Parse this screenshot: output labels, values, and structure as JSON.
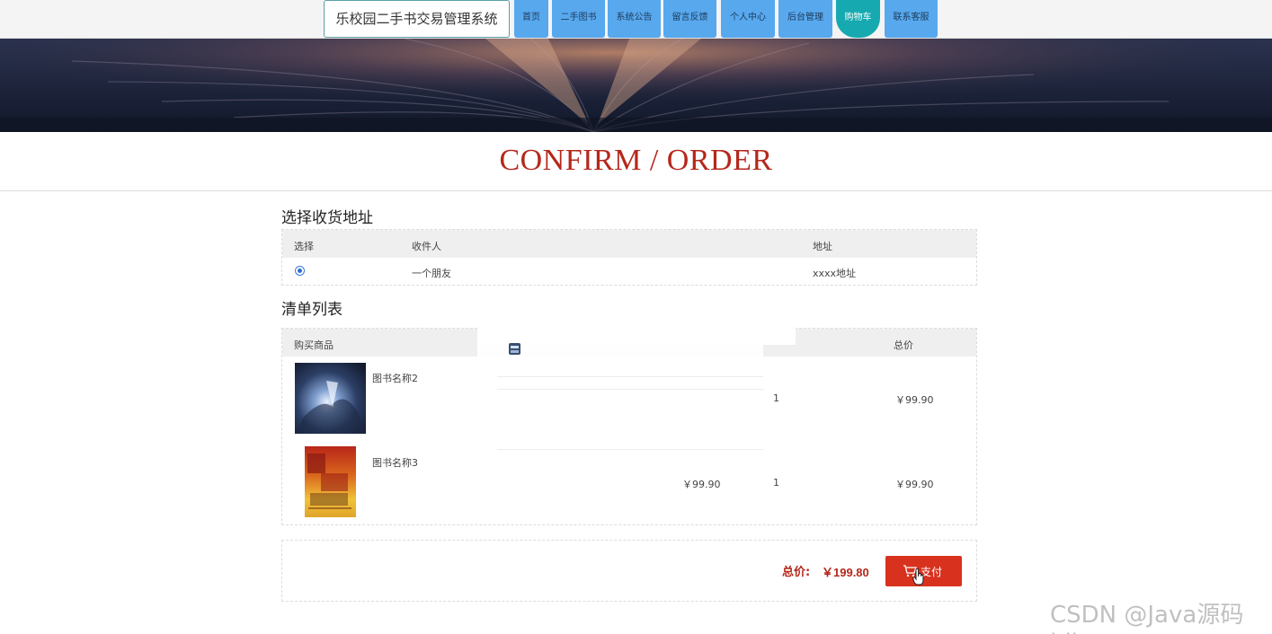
{
  "header": {
    "site_title": "乐校园二手书交易管理系统",
    "nav": [
      {
        "label": "首页"
      },
      {
        "label": "二手图书"
      },
      {
        "label": "系统公告"
      },
      {
        "label": "留言反馈"
      },
      {
        "label": "个人中心"
      },
      {
        "label": "后台管理"
      },
      {
        "label": "购物车",
        "active": true
      },
      {
        "label": "联系客服"
      }
    ]
  },
  "page": {
    "title": "CONFIRM / ORDER"
  },
  "address_section": {
    "heading": "选择收货地址",
    "columns": [
      "选择",
      "收件人",
      "地址"
    ],
    "rows": [
      {
        "selected": true,
        "recipient": "一个朋友",
        "address": "xxxx地址"
      }
    ]
  },
  "order_section": {
    "heading": "清单列表",
    "columns": [
      "购买商品",
      "总价"
    ],
    "items": [
      {
        "name": "图书名称2",
        "unit_price": "",
        "quantity": "1",
        "total": "￥99.90"
      },
      {
        "name": "图书名称3",
        "unit_price": "￥99.90",
        "quantity": "1",
        "total": "￥99.90"
      }
    ]
  },
  "checkout": {
    "total_label": "总价:",
    "total_value": "￥199.80",
    "pay_label": "支付"
  },
  "watermark": "CSDN @Java源码jdk",
  "colors": {
    "accent_red": "#b5271b",
    "pay_button": "#d8321f",
    "nav_blue": "#58a8ee",
    "nav_active": "#16a9b0"
  }
}
